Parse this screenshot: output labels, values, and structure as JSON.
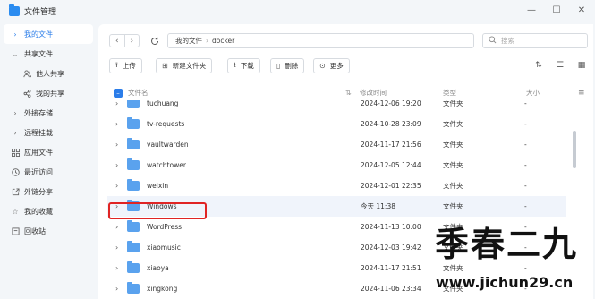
{
  "window": {
    "title": "文件管理",
    "controls": {
      "minimize": "—",
      "maximize": "☐",
      "close": "✕"
    }
  },
  "sidebar": {
    "items": [
      {
        "label": "我的文件",
        "icon": "chevron-right-icon",
        "active": true
      },
      {
        "label": "共享文件",
        "icon": "chevron-down-icon"
      },
      {
        "label": "他人共享",
        "icon": "users-icon"
      },
      {
        "label": "我的共享",
        "icon": "share-icon"
      },
      {
        "label": "外接存储",
        "icon": "chevron-right-icon"
      },
      {
        "label": "远程挂载",
        "icon": "chevron-right-icon"
      },
      {
        "label": "应用文件",
        "icon": "grid-icon"
      },
      {
        "label": "最近访问",
        "icon": "clock-icon"
      },
      {
        "label": "外链分享",
        "icon": "external-link-icon"
      },
      {
        "label": "我的收藏",
        "icon": "star-icon"
      },
      {
        "label": "回收站",
        "icon": "trash-icon"
      }
    ]
  },
  "nav": {
    "path": [
      "我的文件",
      "docker"
    ],
    "search_placeholder": "搜索"
  },
  "toolbar": {
    "upload": "上传",
    "new_folder": "新建文件夹",
    "download": "下载",
    "delete": "删除",
    "more": "更多"
  },
  "table": {
    "headers": {
      "name": "文件名",
      "date": "修改时间",
      "type": "类型",
      "size": "大小"
    },
    "rows": [
      {
        "name": "tuchuang",
        "date": "2024-12-06 19:20",
        "type": "文件夹",
        "size": "-"
      },
      {
        "name": "tv-requests",
        "date": "2024-10-28 23:09",
        "type": "文件夹",
        "size": "-"
      },
      {
        "name": "vaultwarden",
        "date": "2024-11-17 21:56",
        "type": "文件夹",
        "size": "-"
      },
      {
        "name": "watchtower",
        "date": "2024-12-05 12:44",
        "type": "文件夹",
        "size": "-"
      },
      {
        "name": "weixin",
        "date": "2024-12-01 22:35",
        "type": "文件夹",
        "size": "-"
      },
      {
        "name": "Windows",
        "date": "今天 11:38",
        "type": "文件夹",
        "size": "-"
      },
      {
        "name": "WordPress",
        "date": "2024-11-13 10:00",
        "type": "文件夹",
        "size": "-"
      },
      {
        "name": "xiaomusic",
        "date": "2024-12-03 19:42",
        "type": "文件夹",
        "size": "-"
      },
      {
        "name": "xiaoya",
        "date": "2024-11-17 21:51",
        "type": "文件夹",
        "size": "-"
      },
      {
        "name": "xingkong",
        "date": "2024-11-06 23:34",
        "type": "文件夹",
        "size": "-"
      }
    ],
    "highlighted_row": 5
  },
  "watermark": {
    "text": "季春二九",
    "url": "www.jichun29.cn"
  },
  "colors": {
    "accent": "#2b7de9",
    "folder": "#5aa2ee",
    "highlight_box": "#e02424"
  }
}
